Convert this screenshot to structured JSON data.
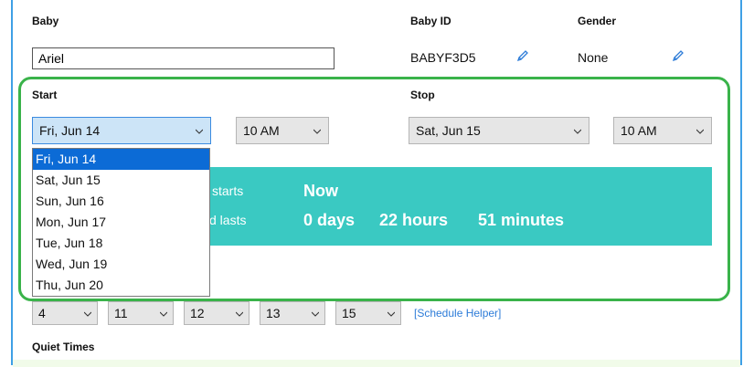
{
  "baby": {
    "label": "Baby",
    "value": "Ariel"
  },
  "baby_id": {
    "label": "Baby ID",
    "value": "BABYF3D5"
  },
  "gender": {
    "label": "Gender",
    "value": "None"
  },
  "start": {
    "label": "Start",
    "date_selected": "Fri, Jun 14",
    "time_selected": "10 AM",
    "options": [
      "Fri, Jun 14",
      "Sat, Jun 15",
      "Sun, Jun 16",
      "Mon, Jun 17",
      "Tue, Jun 18",
      "Wed, Jun 19",
      "Thu, Jun 20"
    ]
  },
  "stop": {
    "label": "Stop",
    "date_selected": "Sat, Jun 15",
    "time_selected": "10 AM"
  },
  "summary": {
    "starts_label": "starts",
    "starts_value": "Now",
    "lasts_label": "d lasts",
    "days": "0 days",
    "hours": "22 hours",
    "minutes": "51 minutes"
  },
  "schedule": {
    "values": [
      "4",
      "11",
      "12",
      "13",
      "15"
    ],
    "helper_link": "[Schedule Helper]"
  },
  "quiet_times": {
    "label": "Quiet Times"
  },
  "colors": {
    "accent_teal": "#3ac9c2",
    "highlight_green": "#3ab34a",
    "selection_blue": "#0c6bd6",
    "link_blue": "#2d7cd8"
  }
}
